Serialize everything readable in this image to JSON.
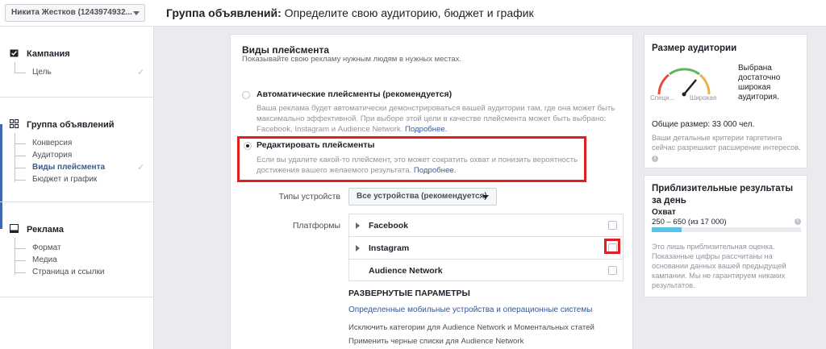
{
  "account": {
    "name": "Никита Жестков (1243974932..."
  },
  "header": {
    "title_bold": "Группа объявлений:",
    "title_rest": " Определите свою аудиторию, бюджет и график"
  },
  "sidebar": {
    "campaign": {
      "label": "Кампания",
      "items": [
        "Цель"
      ]
    },
    "adset": {
      "label": "Группа объявлений",
      "items": [
        "Конверсия",
        "Аудитория",
        "Виды плейсмента",
        "Бюджет и график"
      ]
    },
    "ad": {
      "label": "Реклама",
      "items": [
        "Формат",
        "Медиа",
        "Страница и ссылки"
      ]
    }
  },
  "placements": {
    "title": "Виды плейсмента",
    "subtitle": "Показывайте свою рекламу нужным людям в нужных местах.",
    "auto": {
      "label": "Автоматические плейсменты (рекомендуется)",
      "desc_line1": "Ваша реклама будет автоматически демонстрироваться вашей аудитории там, где она может быть",
      "desc_line2": "максимально эффективной. При выборе этой цели в качестве плейсмента может быть выбрано:",
      "desc_line3": "Facebook, Instagram и Audience Network.",
      "more": "Подробнее."
    },
    "edit": {
      "label": "Редактировать плейсменты",
      "desc_line1": "Если вы удалите какой-то плейсмент, это может сократить охват и понизить вероятность",
      "desc_line2": "достижения вашего желаемого результата.",
      "more": "Подробнее."
    },
    "device_label": "Типы устройств",
    "device_value": "Все устройства (рекомендуется)",
    "platforms_label": "Платформы",
    "platforms": [
      "Facebook",
      "Instagram",
      "Audience Network"
    ],
    "advanced_title": "РАЗВЕРНУТЫЕ ПАРАМЕТРЫ",
    "advanced_link": "Определенные мобильные устройства и операционные системы",
    "advanced_items": [
      "Исключить категории для Audience Network и Моментальных статей",
      "Применить черные списки для Audience Network"
    ]
  },
  "audience_size": {
    "title": "Размер аудитории",
    "gauge_left": "Специ...",
    "gauge_right": "Широкая",
    "status": "Выбрана достаточно широкая аудитория.",
    "total": "Общие размер: 33 000 чел.",
    "note": "Ваши детальные критерии таргетинга сейчас разрешают расширение интересов."
  },
  "estimated": {
    "title": "Приблизительные результаты за день",
    "reach_label": "Охват",
    "reach_value": "250 – 650 (из 17 000)",
    "reach_fraction": 0.2,
    "note": "Это лишь приблизительная оценка. Показанные цифры рассчитаны на основании данных вашей предыдущей кампании. Мы не гарантируем никаких результатов."
  },
  "colors": {
    "accent": "#4267b2",
    "link": "#365899",
    "highlight": "#e02020",
    "reach_bar": "#5bc2e7"
  }
}
